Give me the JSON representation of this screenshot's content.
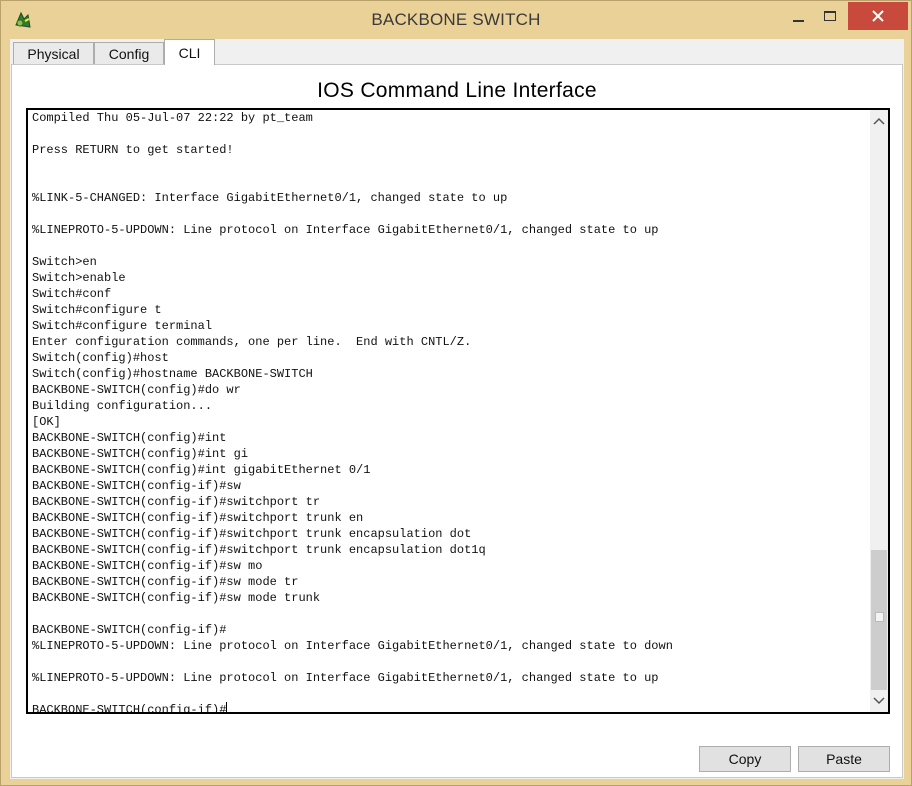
{
  "window": {
    "title": "BACKBONE SWITCH"
  },
  "tabs": [
    {
      "label": "Physical"
    },
    {
      "label": "Config"
    },
    {
      "label": "CLI",
      "active": true
    }
  ],
  "cli": {
    "heading": "IOS Command Line Interface",
    "lines": [
      "Compiled Thu 05-Jul-07 22:22 by pt_team",
      "",
      "Press RETURN to get started!",
      "",
      "",
      "%LINK-5-CHANGED: Interface GigabitEthernet0/1, changed state to up",
      "",
      "%LINEPROTO-5-UPDOWN: Line protocol on Interface GigabitEthernet0/1, changed state to up",
      "",
      "Switch>en",
      "Switch>enable",
      "Switch#conf",
      "Switch#configure t",
      "Switch#configure terminal",
      "Enter configuration commands, one per line.  End with CNTL/Z.",
      "Switch(config)#host",
      "Switch(config)#hostname BACKBONE-SWITCH",
      "BACKBONE-SWITCH(config)#do wr",
      "Building configuration...",
      "[OK]",
      "BACKBONE-SWITCH(config)#int",
      "BACKBONE-SWITCH(config)#int gi",
      "BACKBONE-SWITCH(config)#int gigabitEthernet 0/1",
      "BACKBONE-SWITCH(config-if)#sw",
      "BACKBONE-SWITCH(config-if)#switchport tr",
      "BACKBONE-SWITCH(config-if)#switchport trunk en",
      "BACKBONE-SWITCH(config-if)#switchport trunk encapsulation dot",
      "BACKBONE-SWITCH(config-if)#switchport trunk encapsulation dot1q",
      "BACKBONE-SWITCH(config-if)#sw mo",
      "BACKBONE-SWITCH(config-if)#sw mode tr",
      "BACKBONE-SWITCH(config-if)#sw mode trunk",
      "",
      "BACKBONE-SWITCH(config-if)#",
      "%LINEPROTO-5-UPDOWN: Line protocol on Interface GigabitEthernet0/1, changed state to down",
      "",
      "%LINEPROTO-5-UPDOWN: Line protocol on Interface GigabitEthernet0/1, changed state to up",
      ""
    ],
    "prompt": "BACKBONE-SWITCH(config-if)#",
    "scroll_position": 0.92
  },
  "buttons": {
    "copy": "Copy",
    "paste": "Paste"
  },
  "colors": {
    "title_bar": "#e9d198",
    "close_button": "#c74a3c"
  },
  "icons": [
    "packet-tracer-switch-icon",
    "minimize-icon",
    "maximize-icon",
    "close-icon",
    "chevron-up-icon",
    "chevron-down-icon"
  ]
}
